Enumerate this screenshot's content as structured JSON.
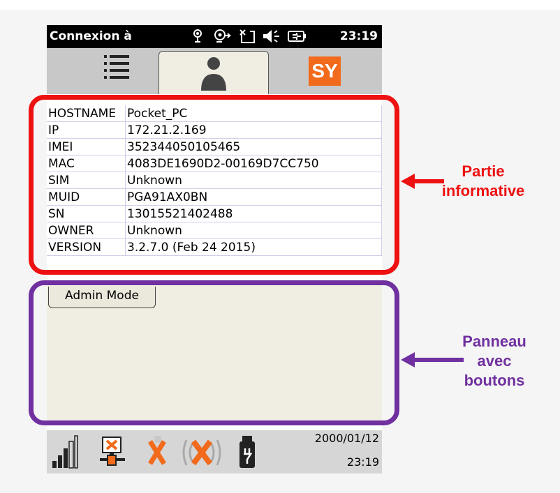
{
  "statusbar": {
    "title": "Connexion à",
    "time": "23:19",
    "icons": [
      "network-icon",
      "sync-icon",
      "message-icon",
      "volume-icon",
      "battery-icon"
    ]
  },
  "tabs": {
    "list_icon": "list-icon",
    "user_icon": "user-icon",
    "sy_logo": "SY"
  },
  "info": {
    "rows": [
      {
        "key": "HOSTNAME",
        "value": "Pocket_PC"
      },
      {
        "key": "IP",
        "value": "172.21.2.169"
      },
      {
        "key": "IMEI",
        "value": "352344050105465"
      },
      {
        "key": "MAC",
        "value": "4083DE1690D2-00169D7CC750"
      },
      {
        "key": "SIM",
        "value": "Unknown"
      },
      {
        "key": "MUID",
        "value": "PGA91AX0BN"
      },
      {
        "key": "SN",
        "value": "13015521402488"
      },
      {
        "key": "OWNER",
        "value": "Unknown"
      },
      {
        "key": "VERSION",
        "value": "3.2.7.0 (Feb 24 2015)"
      }
    ]
  },
  "panel": {
    "admin_button": "Admin Mode"
  },
  "bottombar": {
    "date": "2000/01/12",
    "time": "23:19",
    "icons": [
      "signal-strength-icon",
      "network-disconnected-icon",
      "bluetooth-off-icon",
      "wifi-off-icon",
      "power-plug-icon"
    ]
  },
  "annotations": {
    "info_label": [
      "Partie",
      "informative"
    ],
    "panel_label": [
      "Panneau",
      "avec",
      "boutons"
    ]
  },
  "colors": {
    "annotation_red": "#ee1111",
    "annotation_purple": "#7030a0",
    "sy_orange": "#f26a1b"
  }
}
